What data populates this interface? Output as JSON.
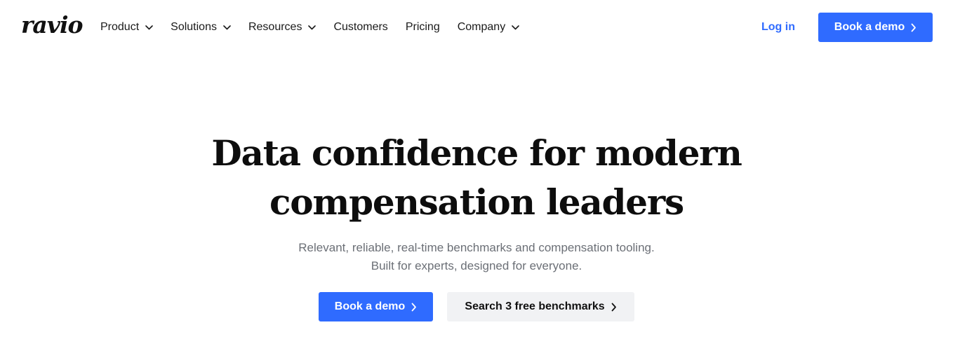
{
  "brand": {
    "logo_text": "ravio"
  },
  "nav": {
    "items": [
      {
        "label": "Product",
        "has_dropdown": true
      },
      {
        "label": "Solutions",
        "has_dropdown": true
      },
      {
        "label": "Resources",
        "has_dropdown": true
      },
      {
        "label": "Customers",
        "has_dropdown": false
      },
      {
        "label": "Pricing",
        "has_dropdown": false
      },
      {
        "label": "Company",
        "has_dropdown": true
      }
    ],
    "login_label": "Log in",
    "demo_label": "Book a demo"
  },
  "hero": {
    "title_line1": "Data confidence for modern",
    "title_line2": "compensation leaders",
    "subtitle_line1": "Relevant, reliable, real-time benchmarks and compensation tooling.",
    "subtitle_line2": "Built for experts, designed for everyone.",
    "primary_cta": "Book a demo",
    "secondary_cta": "Search 3 free benchmarks"
  },
  "colors": {
    "accent": "#2f6bff",
    "text": "#111111",
    "muted_text": "#6b6f76",
    "secondary_button_bg": "#f1f2f4",
    "background": "#ffffff"
  },
  "icons": {
    "dropdown": "chevron-down-icon",
    "arrow": "chevron-right-icon"
  }
}
